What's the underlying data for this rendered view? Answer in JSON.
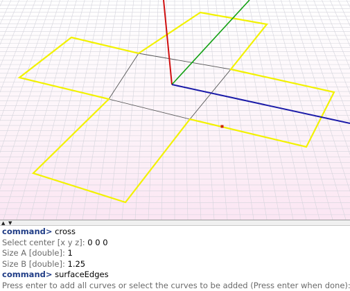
{
  "colors": {
    "background_top": "#ffffff",
    "background_bottom": "#fbe6f3",
    "grid": "#d4d4dc",
    "axis_x": "#1a1aa8",
    "axis_y": "#10a010",
    "axis_z": "#d01010",
    "cross_outline": "#f2f200",
    "command_keyword": "#1f3c86",
    "prompt_text": "#6a6a6a"
  },
  "splitter": {
    "up_icon": "triangle-up",
    "down_icon": "triangle-down"
  },
  "console": {
    "lines": [
      {
        "keyword": "command>",
        "text": " cross"
      },
      {
        "prompt": "Select center [x y z]:",
        "value": " 0 0 0"
      },
      {
        "prompt": "Size A [double]:",
        "value": " 1"
      },
      {
        "prompt": "Size B [double]:",
        "value": " 1.25"
      },
      {
        "keyword": "command>",
        "text": " surfaceEdges"
      },
      {
        "prompt": "Press enter to add all curves or select the curves to be added (Press enter when done):",
        "value": ""
      }
    ]
  }
}
